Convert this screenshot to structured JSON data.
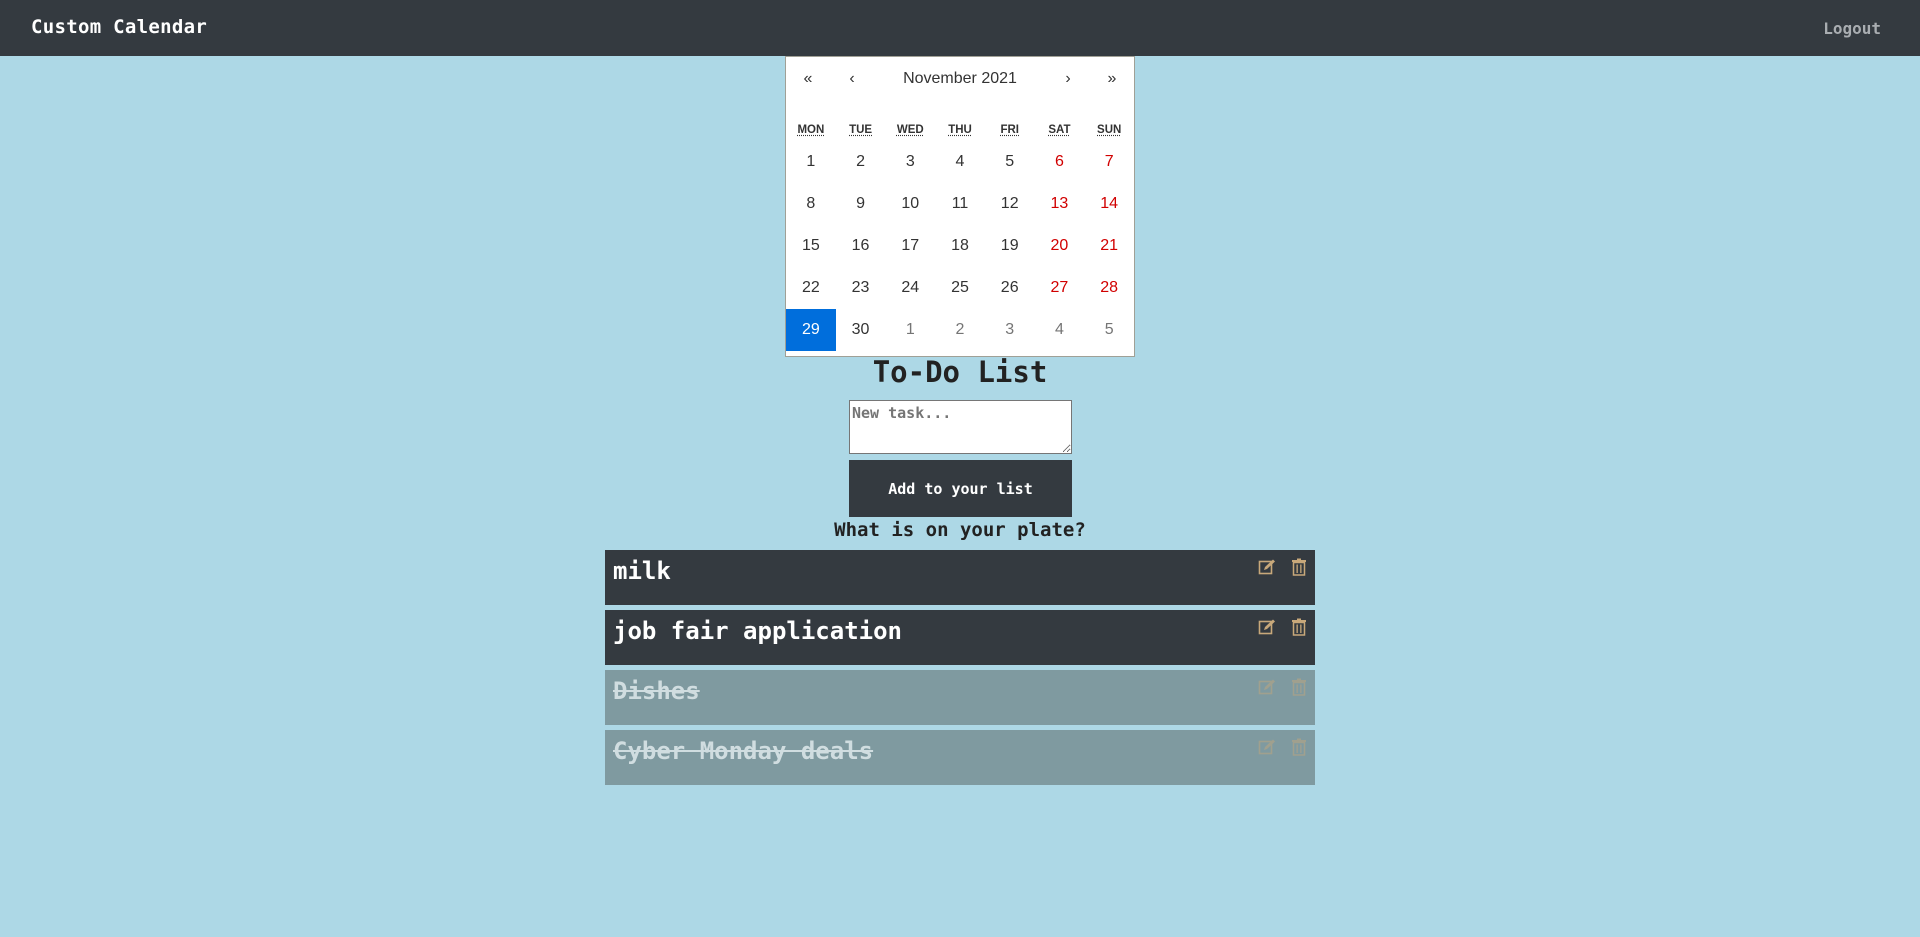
{
  "navbar": {
    "brand": "Custom Calendar",
    "logout": "Logout"
  },
  "calendar": {
    "nav": {
      "prev_year": "«",
      "prev_month": "‹",
      "label": "November 2021",
      "next_month": "›",
      "next_year": "»"
    },
    "weekdays": [
      "MON",
      "TUE",
      "WED",
      "THU",
      "FRI",
      "SAT",
      "SUN"
    ],
    "days": [
      {
        "d": "1",
        "t": ""
      },
      {
        "d": "2",
        "t": ""
      },
      {
        "d": "3",
        "t": ""
      },
      {
        "d": "4",
        "t": ""
      },
      {
        "d": "5",
        "t": ""
      },
      {
        "d": "6",
        "t": "weekend"
      },
      {
        "d": "7",
        "t": "weekend"
      },
      {
        "d": "8",
        "t": ""
      },
      {
        "d": "9",
        "t": ""
      },
      {
        "d": "10",
        "t": ""
      },
      {
        "d": "11",
        "t": ""
      },
      {
        "d": "12",
        "t": ""
      },
      {
        "d": "13",
        "t": "weekend"
      },
      {
        "d": "14",
        "t": "weekend"
      },
      {
        "d": "15",
        "t": ""
      },
      {
        "d": "16",
        "t": ""
      },
      {
        "d": "17",
        "t": ""
      },
      {
        "d": "18",
        "t": ""
      },
      {
        "d": "19",
        "t": ""
      },
      {
        "d": "20",
        "t": "weekend"
      },
      {
        "d": "21",
        "t": "weekend"
      },
      {
        "d": "22",
        "t": ""
      },
      {
        "d": "23",
        "t": ""
      },
      {
        "d": "24",
        "t": ""
      },
      {
        "d": "25",
        "t": ""
      },
      {
        "d": "26",
        "t": ""
      },
      {
        "d": "27",
        "t": "weekend"
      },
      {
        "d": "28",
        "t": "weekend"
      },
      {
        "d": "29",
        "t": "active"
      },
      {
        "d": "30",
        "t": ""
      },
      {
        "d": "1",
        "t": "neighbor"
      },
      {
        "d": "2",
        "t": "neighbor"
      },
      {
        "d": "3",
        "t": "neighbor"
      },
      {
        "d": "4",
        "t": "neighbor"
      },
      {
        "d": "5",
        "t": "neighbor"
      }
    ],
    "colors": {
      "weekend": "#d10000",
      "active": "#006edc"
    }
  },
  "todo": {
    "title": "To-Do List",
    "input_placeholder": "New task...",
    "add_button": "Add to your list",
    "subtitle": "What is on your plate?",
    "items": [
      {
        "text": "milk",
        "done": false
      },
      {
        "text": "job fair application",
        "done": false
      },
      {
        "text": "Dishes",
        "done": true
      },
      {
        "text": "Cyber Monday deals",
        "done": true
      }
    ],
    "icons": {
      "edit": "edit-icon",
      "delete": "trash-icon"
    }
  }
}
